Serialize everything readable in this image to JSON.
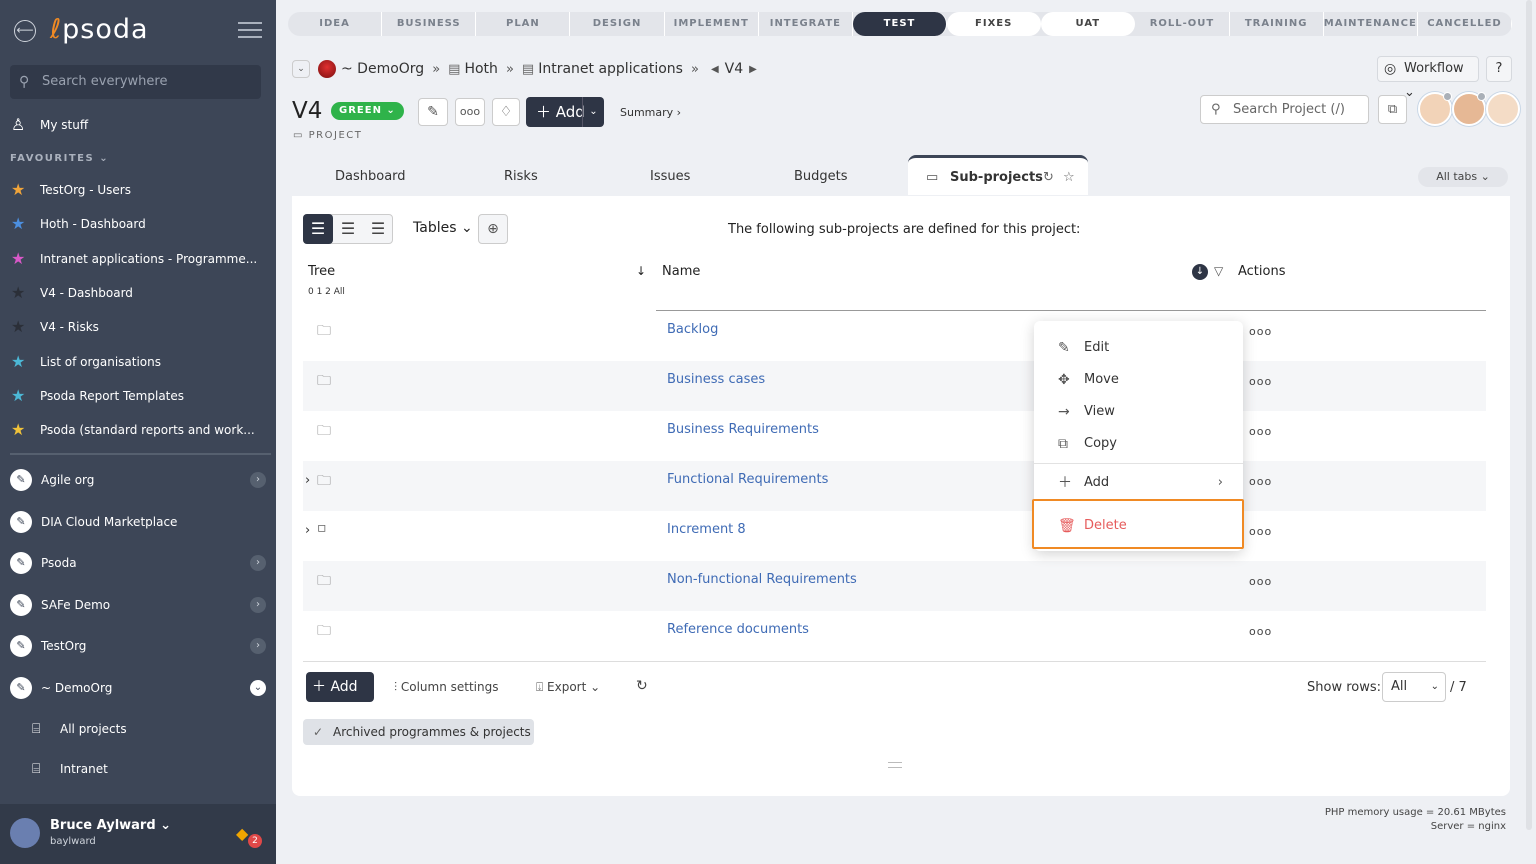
{
  "sidebar": {
    "logo": "psoda",
    "search_placeholder": "Search everywhere",
    "my_stuff": "My stuff",
    "favourites_label": "FAVOURITES",
    "favourites": [
      {
        "label": "TestOrg - Users",
        "color": "#f0a43a"
      },
      {
        "label": "Hoth - Dashboard",
        "color": "#4c8fe0"
      },
      {
        "label": "Intranet applications - Programme...",
        "color": "#d958c8"
      },
      {
        "label": "V4 - Dashboard",
        "color": "#2b2f38"
      },
      {
        "label": "V4 - Risks",
        "color": "#2b2f38"
      },
      {
        "label": "List of organisations",
        "color": "#4cb8d6"
      },
      {
        "label": "Psoda Report Templates",
        "color": "#4cb8d6"
      },
      {
        "label": "Psoda (standard reports and work...",
        "color": "#f0c23a"
      }
    ],
    "orgs": [
      {
        "label": "Agile org",
        "has_children": true
      },
      {
        "label": "DIA Cloud Marketplace",
        "has_children": false
      },
      {
        "label": "Psoda",
        "has_children": true
      },
      {
        "label": "SAFe Demo",
        "has_children": true
      },
      {
        "label": "TestOrg",
        "has_children": true
      },
      {
        "label": "~ DemoOrg",
        "has_children": true
      }
    ],
    "sub_items": [
      "All projects",
      "Intranet"
    ],
    "user": {
      "name": "Bruce Aylward",
      "login": "baylward",
      "notifications": "2"
    }
  },
  "phases": [
    {
      "label": "IDEA",
      "state": "past"
    },
    {
      "label": "BUSINESS CASE",
      "state": "past"
    },
    {
      "label": "PLAN",
      "state": "past"
    },
    {
      "label": "DESIGN",
      "state": "past"
    },
    {
      "label": "IMPLEMENT",
      "state": "past"
    },
    {
      "label": "INTEGRATE",
      "state": "past"
    },
    {
      "label": "TEST",
      "state": "active"
    },
    {
      "label": "FIXES",
      "state": "next"
    },
    {
      "label": "UAT",
      "state": "next"
    },
    {
      "label": "ROLL-OUT",
      "state": "future"
    },
    {
      "label": "TRAINING",
      "state": "future"
    },
    {
      "label": "MAINTENANCE",
      "state": "future"
    },
    {
      "label": "CANCELLED",
      "state": "future"
    }
  ],
  "breadcrumb": {
    "org": "~ DemoOrg",
    "program": "Hoth",
    "programme": "Intranet applications",
    "project": "V4"
  },
  "header": {
    "workflow_label": "Workflow",
    "help_label": "?",
    "title": "V4",
    "rag": "GREEN",
    "rag_color": "#2fb34a",
    "type": "PROJECT",
    "add_label": "Add",
    "summary_label": "Summary ›",
    "search_placeholder": "Search Project (/)"
  },
  "tabs": [
    "Dashboard",
    "Risks",
    "Issues",
    "Budgets",
    "Sub-projects"
  ],
  "all_tabs": "All tabs",
  "content": {
    "tables_label": "Tables",
    "intro": "The following sub-projects are defined for this project:",
    "col_tree": "Tree",
    "tree_levels": "0 1 2 All",
    "col_name": "Name",
    "col_actions": "Actions",
    "rows": [
      {
        "name": "Backlog",
        "expandable": false
      },
      {
        "name": "Business cases",
        "expandable": false
      },
      {
        "name": "Business Requirements",
        "expandable": false
      },
      {
        "name": "Functional Requirements",
        "expandable": true
      },
      {
        "name": "Increment 8",
        "expandable": true
      },
      {
        "name": "Non-functional Requirements",
        "expandable": false
      },
      {
        "name": "Reference documents",
        "expandable": false
      }
    ],
    "add_label": "Add",
    "column_settings": "Column settings",
    "export": "Export",
    "show_rows_label": "Show rows:",
    "show_rows_value": "All",
    "total": "/ 7",
    "archived": "Archived programmes & projects"
  },
  "context_menu": {
    "edit": "Edit",
    "move": "Move",
    "view": "View",
    "copy": "Copy",
    "add": "Add",
    "delete": "Delete",
    "highlight_color": "#f08a24"
  },
  "footer": {
    "memory": "PHP memory usage = 20.61 MBytes",
    "server": "Server = nginx"
  }
}
